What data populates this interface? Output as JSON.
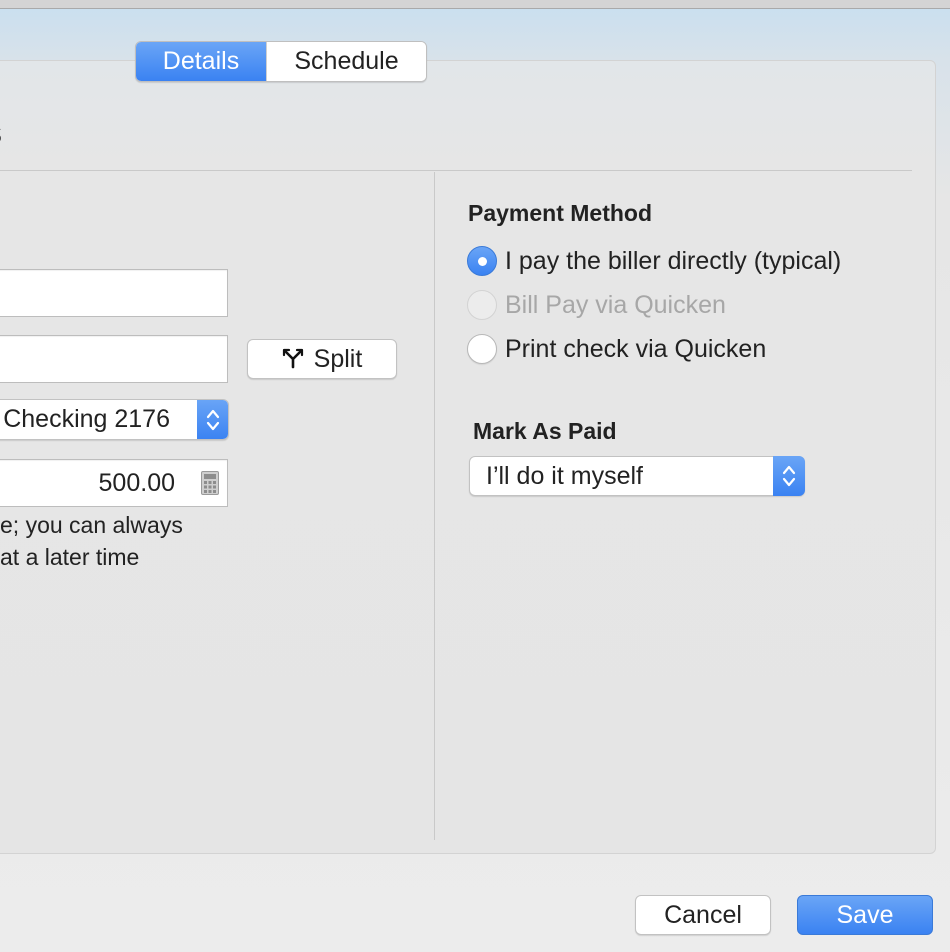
{
  "window": {
    "heading_fragment": "s"
  },
  "tabs": [
    {
      "label": "Details",
      "selected": true
    },
    {
      "label": "Schedule",
      "selected": false
    }
  ],
  "details": {
    "split_label": "Split",
    "account_value": "Checking 2176",
    "amount_value": "500.00",
    "note_line_1": "e; you can always",
    "note_line_2": "at a later time"
  },
  "payment_method": {
    "label": "Payment Method",
    "options": [
      {
        "label": "I pay the biller directly (typical)",
        "selected": true,
        "enabled": true
      },
      {
        "label": "Bill Pay via Quicken",
        "selected": false,
        "enabled": false
      },
      {
        "label": "Print check via Quicken",
        "selected": false,
        "enabled": true
      }
    ]
  },
  "mark_as_paid": {
    "label": "Mark As Paid",
    "value": "I’ll do it myself"
  },
  "actions": {
    "cancel_label": "Cancel",
    "save_label": "Save"
  },
  "colors": {
    "accent": "#3a82f2",
    "panel_bg": "#e6e6e6",
    "disabled_text": "#a7a7a7"
  },
  "icons": {
    "split": "split-icon",
    "calculator": "calculator-icon",
    "stepper": "chevron-up-down-icon"
  }
}
